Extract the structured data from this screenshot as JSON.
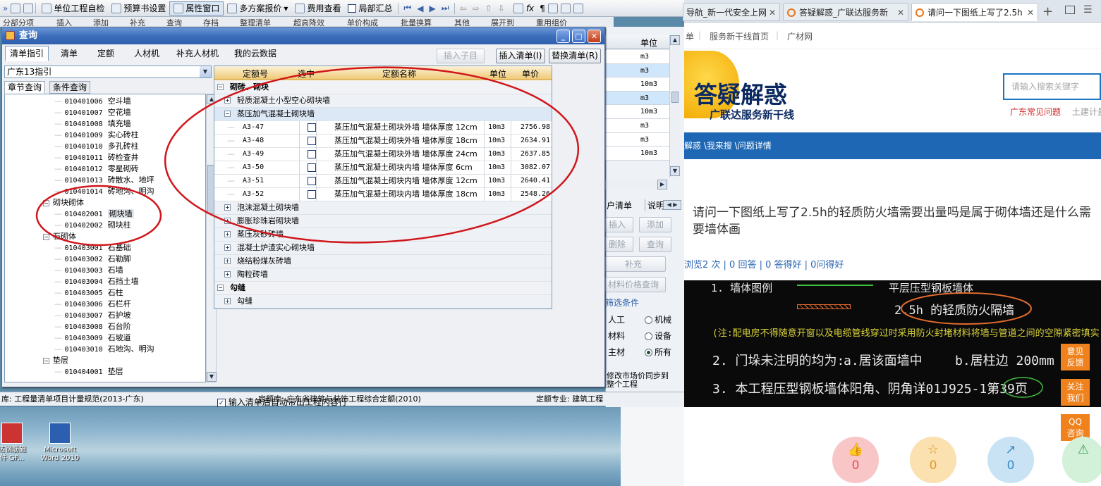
{
  "app_toolbar": {
    "items": [
      "单位工程自检",
      "预算书设置",
      "属性窗口",
      "多方案报价",
      "费用查看",
      "局部汇总"
    ],
    "row2": [
      "分部分项",
      "插入",
      "添加",
      "补充",
      "查询",
      "存档",
      "整理清单",
      "超高降效",
      "单价构成",
      "批量换算",
      "其他",
      "展开到",
      "重用组价"
    ]
  },
  "main_grid": {
    "header": "单位",
    "units": [
      "m3",
      "m3",
      "10m3",
      "m3",
      "10m3",
      "m3",
      "m3",
      "10m3"
    ],
    "side_tabs": [
      "户清单",
      "说明"
    ],
    "buttons": [
      "插入",
      "添加",
      "删除",
      "查询",
      "补充",
      "材料价格查询"
    ],
    "filter_label": "筛选条件",
    "filters": [
      {
        "label": "人工",
        "option": "机械"
      },
      {
        "label": "材料",
        "option": "设备"
      },
      {
        "label": "主材",
        "option": "所有"
      }
    ],
    "bottom_note": "修改市场价同步到整个工程"
  },
  "status_bar": {
    "left": "库: 工程量清单项目计量规范(2013-广东)",
    "middle": "定额库: 广东省建筑与装饰工程综合定额(2010)",
    "right": "定额专业: 建筑工程"
  },
  "desktop": {
    "icons": [
      {
        "label": "达钢筋施\n件 GF...",
        "icon": "app-icon"
      },
      {
        "label": "Microsoft\nWord 2010",
        "icon": "word-icon"
      }
    ]
  },
  "dialog": {
    "title": "查询",
    "tabs": [
      "清单指引",
      "清单",
      "定额",
      "人材机",
      "补充人材机",
      "我的云数据"
    ],
    "buttons": {
      "insert_child": "插入子目",
      "insert_list": "插入清单(I)",
      "replace_list": "替换清单(R)"
    },
    "combo_value": "广东13指引",
    "subtabs": [
      "章节查询",
      "条件查询"
    ],
    "tree": [
      {
        "code": "010401006",
        "name": "空斗墙",
        "level": 3
      },
      {
        "code": "010401007",
        "name": "空花墙",
        "level": 3
      },
      {
        "code": "010401008",
        "name": "填充墙",
        "level": 3
      },
      {
        "code": "010401009",
        "name": "实心砖柱",
        "level": 3
      },
      {
        "code": "010401010",
        "name": "多孔砖柱",
        "level": 3
      },
      {
        "code": "010401011",
        "name": "砖检查井",
        "level": 3
      },
      {
        "code": "010401012",
        "name": "零星砌砖",
        "level": 3
      },
      {
        "code": "010401013",
        "name": "砖散水、地坪",
        "level": 3
      },
      {
        "code": "010401014",
        "name": "砖地沟、明沟",
        "level": 3
      },
      {
        "code": "",
        "name": "砌块砌体",
        "level": 2,
        "toggle": "−"
      },
      {
        "code": "010402001",
        "name": "砌块墙",
        "level": 3,
        "selected": true
      },
      {
        "code": "010402002",
        "name": "砌块柱",
        "level": 3
      },
      {
        "code": "",
        "name": "石砌体",
        "level": 2,
        "toggle": "−"
      },
      {
        "code": "010403001",
        "name": "石基础",
        "level": 3
      },
      {
        "code": "010403002",
        "name": "石勒脚",
        "level": 3
      },
      {
        "code": "010403003",
        "name": "石墙",
        "level": 3
      },
      {
        "code": "010403004",
        "name": "石挡土墙",
        "level": 3
      },
      {
        "code": "010403005",
        "name": "石柱",
        "level": 3
      },
      {
        "code": "010403006",
        "name": "石栏杆",
        "level": 3
      },
      {
        "code": "010403007",
        "name": "石护坡",
        "level": 3
      },
      {
        "code": "010403008",
        "name": "石台阶",
        "level": 3
      },
      {
        "code": "010403009",
        "name": "石坡道",
        "level": 3
      },
      {
        "code": "010403010",
        "name": "石地沟、明沟",
        "level": 3
      },
      {
        "code": "",
        "name": "垫层",
        "level": 2,
        "toggle": "−"
      },
      {
        "code": "010404001",
        "name": "垫层",
        "level": 3
      }
    ],
    "grid": {
      "headers": {
        "code": "定额号",
        "check": "选中",
        "name": "定额名称",
        "unit": "单位",
        "price": "单价"
      },
      "rows": [
        {
          "kind": "group",
          "toggle": "−",
          "text": "砌砖、砌块"
        },
        {
          "kind": "sub",
          "toggle": "+",
          "text": "轻质混凝土小型空心砌块墙"
        },
        {
          "kind": "sub",
          "toggle": "−",
          "text": "蒸压加气混凝土砌块墙",
          "selected": true
        },
        {
          "kind": "item",
          "code": "A3-47",
          "checked": false,
          "name": "蒸压加气混凝土砌块外墙 墙体厚度 12cm",
          "unit": "10m3",
          "price": "2756.98"
        },
        {
          "kind": "item",
          "code": "A3-48",
          "checked": false,
          "name": "蒸压加气混凝土砌块外墙 墙体厚度 18cm",
          "unit": "10m3",
          "price": "2634.91"
        },
        {
          "kind": "item",
          "code": "A3-49",
          "checked": false,
          "name": "蒸压加气混凝土砌块外墙 墙体厚度 24cm",
          "unit": "10m3",
          "price": "2637.85"
        },
        {
          "kind": "item",
          "code": "A3-50",
          "checked": false,
          "name": "蒸压加气混凝土砌块内墙 墙体厚度 6cm",
          "unit": "10m3",
          "price": "3082.07"
        },
        {
          "kind": "item",
          "code": "A3-51",
          "checked": false,
          "name": "蒸压加气混凝土砌块内墙 墙体厚度 12cm",
          "unit": "10m3",
          "price": "2640.41"
        },
        {
          "kind": "item",
          "code": "A3-52",
          "checked": false,
          "name": "蒸压加气混凝土砌块内墙 墙体厚度 18cm",
          "unit": "10m3",
          "price": "2548.26"
        },
        {
          "kind": "sub",
          "toggle": "+",
          "text": "泡沫混凝土砌块墙"
        },
        {
          "kind": "sub",
          "toggle": "+",
          "text": "膨胀珍珠岩砌块墙"
        },
        {
          "kind": "sub",
          "toggle": "+",
          "text": "蒸压灰砂砖墙"
        },
        {
          "kind": "sub",
          "toggle": "+",
          "text": "混凝土炉渣实心砌块墙"
        },
        {
          "kind": "sub",
          "toggle": "+",
          "text": "烧结粉煤灰砖墙"
        },
        {
          "kind": "sub",
          "toggle": "+",
          "text": "陶粒砖墙"
        },
        {
          "kind": "group",
          "toggle": "−",
          "text": "勾缝"
        },
        {
          "kind": "sub",
          "toggle": "+",
          "text": "勾缝"
        }
      ]
    },
    "auto_check_label": "输入清单后自动带出工程内容行",
    "auto_checked": true
  },
  "browser": {
    "tabs": [
      "导航_新一代安全上网",
      "答疑解惑_广联达服务新",
      "请问一下图纸上写了2.5h"
    ],
    "nav_links": [
      "单",
      "服务新干线首页",
      "广材网"
    ],
    "logo": "答疑解惑",
    "logo_sub": "广联达服务新干线",
    "search_placeholder": "请输入搜索关键字",
    "hot_links": [
      "广东常见问题",
      "土建计量"
    ],
    "breadcrumb": "解惑 \\我来搜 \\问题详情",
    "question_title": "请问一下图纸上写了2.5h的轻质防火墙需要出量吗是属于砌体墙还是什么需要墙体画",
    "stats": "浏览2 次 | 0 回答 | 0 答得好 | 0问得好",
    "drawing_lines": [
      "1. 墙体图例",
      "平层压型钢板墙体",
      "2.5h 的轻质防火隔墙",
      "(注:配电房不得随意开窗以及电缆管线穿过时采用防火封堵材料将墙与管道之间的空隙紧密填实)",
      "2. 门垛未注明的均为:",
      "a.居该面墙中",
      "b.居柱边  200mm",
      "3. 本工程压型钢板墙体阳角、阴角详01J925-1第39页"
    ],
    "side_buttons": [
      "意见\n反馈",
      "关注\n我们",
      "QQ\n咨询"
    ],
    "reactions": [
      {
        "icon": "thumbs-up-icon",
        "count": "0",
        "color": "#f9c6c8"
      },
      {
        "icon": "star-icon",
        "count": "0",
        "color": "#fbe0b0"
      },
      {
        "icon": "share-icon",
        "count": "0",
        "color": "#c9e3f4"
      }
    ]
  }
}
